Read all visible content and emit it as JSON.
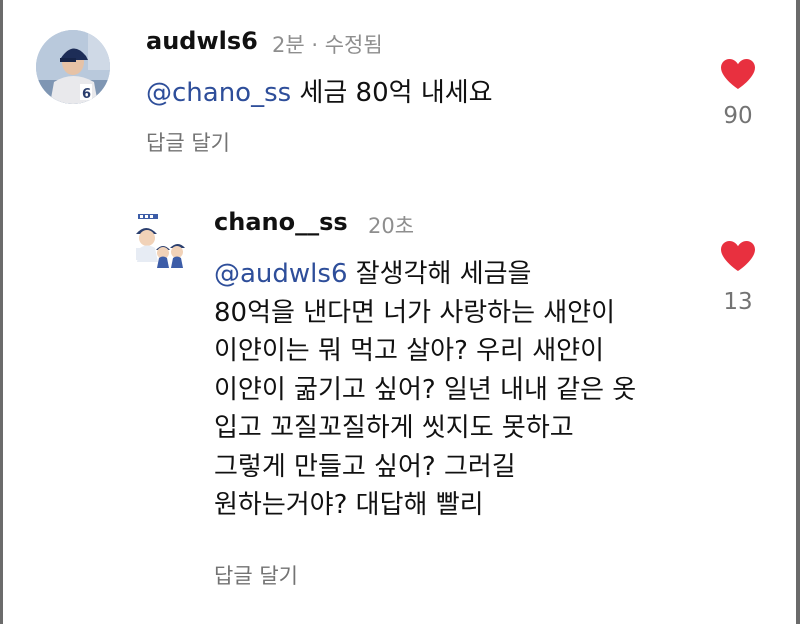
{
  "comment": {
    "username": "audwls6",
    "meta": "2분 · 수정됨",
    "mention": "@chano_ss",
    "text": " 세금 80억 내세요",
    "reply_label": "답글 달기",
    "like_count": "90",
    "like_icon": "heart-filled-icon",
    "like_color": "#e8303f"
  },
  "reply": {
    "username": "chano__ss",
    "meta": "20초",
    "mention": "@audwls6",
    "lines": [
      " 잘생각해 세금을",
      "80억을 낸다면 너가 사랑하는 새얀이",
      "이얀이는 뭐 먹고 살아? 우리 새얀이",
      "이얀이 굶기고 싶어? 일년 내내 같은 옷",
      "입고 꼬질꼬질하게 씻지도 못하고",
      "그렇게 만들고 싶어? 그러길",
      "원하는거야? 대답해 빨리"
    ],
    "reply_label": "답글 달기",
    "like_count": "13",
    "like_icon": "heart-filled-icon",
    "like_color": "#e8303f"
  },
  "colors": {
    "mention": "#2e4e9a",
    "meta_text": "#8e8e8e",
    "frame": "#6b6b6b"
  }
}
